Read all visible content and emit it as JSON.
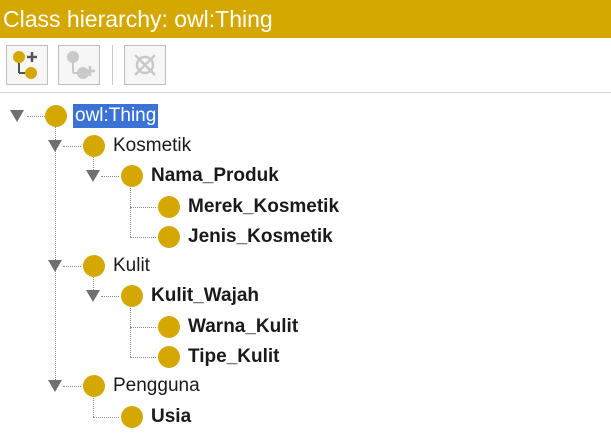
{
  "panel": {
    "title": "Class hierarchy: owl:Thing",
    "accent_color": "#d4a800",
    "selection_color": "#3a72d6"
  },
  "toolbar": {
    "buttons": [
      {
        "icon": "add-subclass-icon",
        "enabled": true
      },
      {
        "icon": "add-sibling-class-icon",
        "enabled": false
      },
      {
        "icon": "delete-class-icon",
        "enabled": false
      }
    ]
  },
  "tree": {
    "root": {
      "label": "owl:Thing",
      "selected": true,
      "expanded": true
    },
    "kosmetik": {
      "label": "Kosmetik",
      "expanded": true
    },
    "nama_produk": {
      "label": "Nama_Produk",
      "expanded": true
    },
    "merek_kosmetik": {
      "label": "Merek_Kosmetik"
    },
    "jenis_kosmetik": {
      "label": "Jenis_Kosmetik"
    },
    "kulit": {
      "label": "Kulit",
      "expanded": true
    },
    "kulit_wajah": {
      "label": "Kulit_Wajah",
      "expanded": true
    },
    "warna_kulit": {
      "label": "Warna_Kulit"
    },
    "tipe_kulit": {
      "label": "Tipe_Kulit"
    },
    "pengguna": {
      "label": "Pengguna",
      "expanded": true
    },
    "usia": {
      "label": "Usia"
    }
  }
}
